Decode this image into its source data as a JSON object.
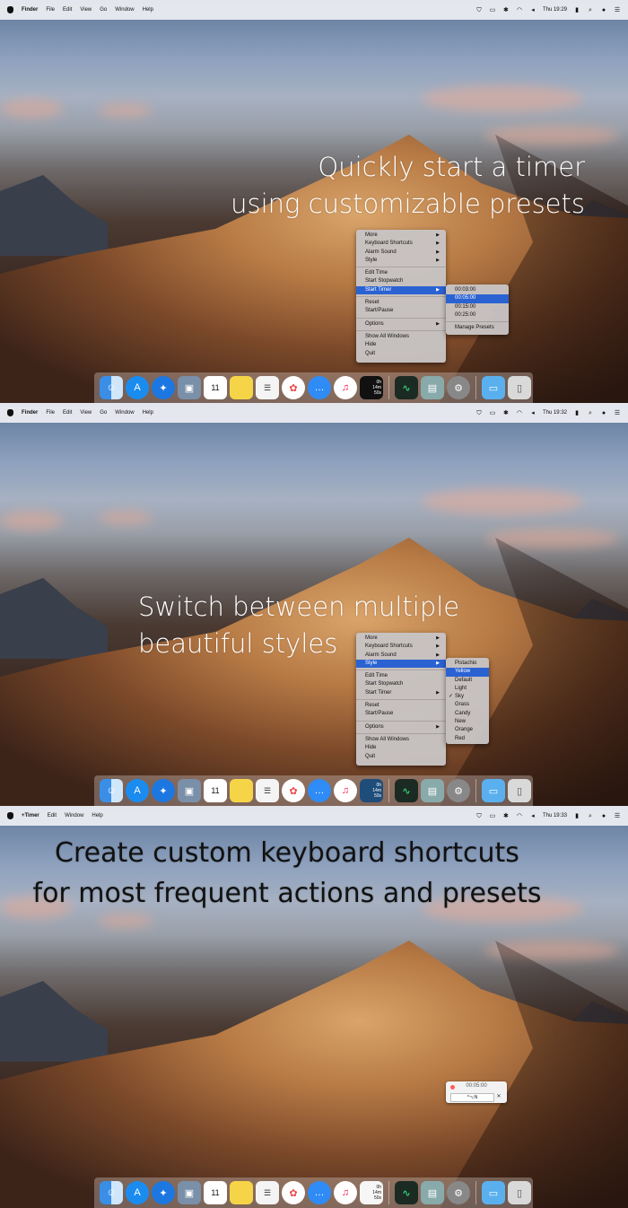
{
  "panels": [
    {
      "menubar": {
        "app": "Finder",
        "items": [
          "File",
          "Edit",
          "View",
          "Go",
          "Window",
          "Help"
        ],
        "clock": "Thu 19:29"
      },
      "caption": [
        "Quickly start a timer",
        "using customizable presets"
      ]
    },
    {
      "menubar": {
        "app": "Finder",
        "items": [
          "File",
          "Edit",
          "View",
          "Go",
          "Window",
          "Help"
        ],
        "clock": "Thu 19:32"
      },
      "caption": [
        "Switch between multiple",
        "beautiful styles"
      ]
    },
    {
      "menubar": {
        "app": "+Timer",
        "items": [
          "Edit",
          "Window",
          "Help"
        ],
        "clock": "Thu 19:33"
      },
      "caption": [
        "Create custom keyboard shortcuts",
        "for most frequent actions and presets"
      ]
    }
  ],
  "context_menu": {
    "group1": [
      "More",
      "Keyboard Shortcuts",
      "Alarm Sound",
      "Style"
    ],
    "group2": [
      "Edit Time",
      "Start Stopwatch",
      "Start Timer"
    ],
    "group3": [
      "Reset",
      "Start/Pause"
    ],
    "group4": [
      "Options"
    ],
    "group5": [
      "Show All Windows",
      "Hide",
      "Quit"
    ],
    "submenu_arrow": "▶"
  },
  "presets_submenu": {
    "items": [
      "00:03:00",
      "00:05:00",
      "00:15:00",
      "00:25:00"
    ],
    "selected": "00:05:00",
    "manage": "Manage Presets"
  },
  "style_submenu": {
    "items": [
      "Pistachio",
      "Yellow",
      "Default",
      "Light",
      "Sky",
      "Grass",
      "Candy",
      "New",
      "Orange",
      "Red"
    ],
    "highlighted": "Yellow",
    "checked": "Sky",
    "check_mark": "✓"
  },
  "dock_timer": {
    "lines": [
      "0h",
      "14m",
      "50s"
    ]
  },
  "dock_calendar": {
    "day": "11"
  },
  "mini_window": {
    "time": "00:05:00",
    "shortcut": "^⌥N",
    "clear": "✕"
  },
  "colors": {
    "menu_highlight": "#2a62d2",
    "menubar": "#f0f0f4"
  }
}
